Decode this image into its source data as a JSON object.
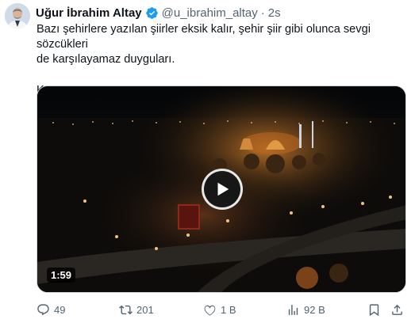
{
  "author": {
    "name": "Uğur İbrahim Altay",
    "handle": "@u_ibrahim_altay",
    "separator": "·",
    "time": "2s"
  },
  "post": {
    "line1": "Bazı şehirlere yazılan şiirler eksik kalır, şehir şiir gibi olunca sevgi sözcükleri",
    "line2": "de karşılayamaz duyguları.",
    "location": "Konya",
    "heart": "❤"
  },
  "media": {
    "duration": "1:59"
  },
  "actions": {
    "replies": "49",
    "reposts": "201",
    "likes": "1 B",
    "views": "92 B"
  },
  "colors": {
    "verified": "#1d9bf0",
    "heart": "#f91880",
    "secondary_text": "#536471"
  },
  "icons": [
    "verified-badge-icon",
    "play-icon",
    "reply-icon",
    "repost-icon",
    "like-icon",
    "views-icon",
    "bookmark-icon",
    "share-icon"
  ]
}
